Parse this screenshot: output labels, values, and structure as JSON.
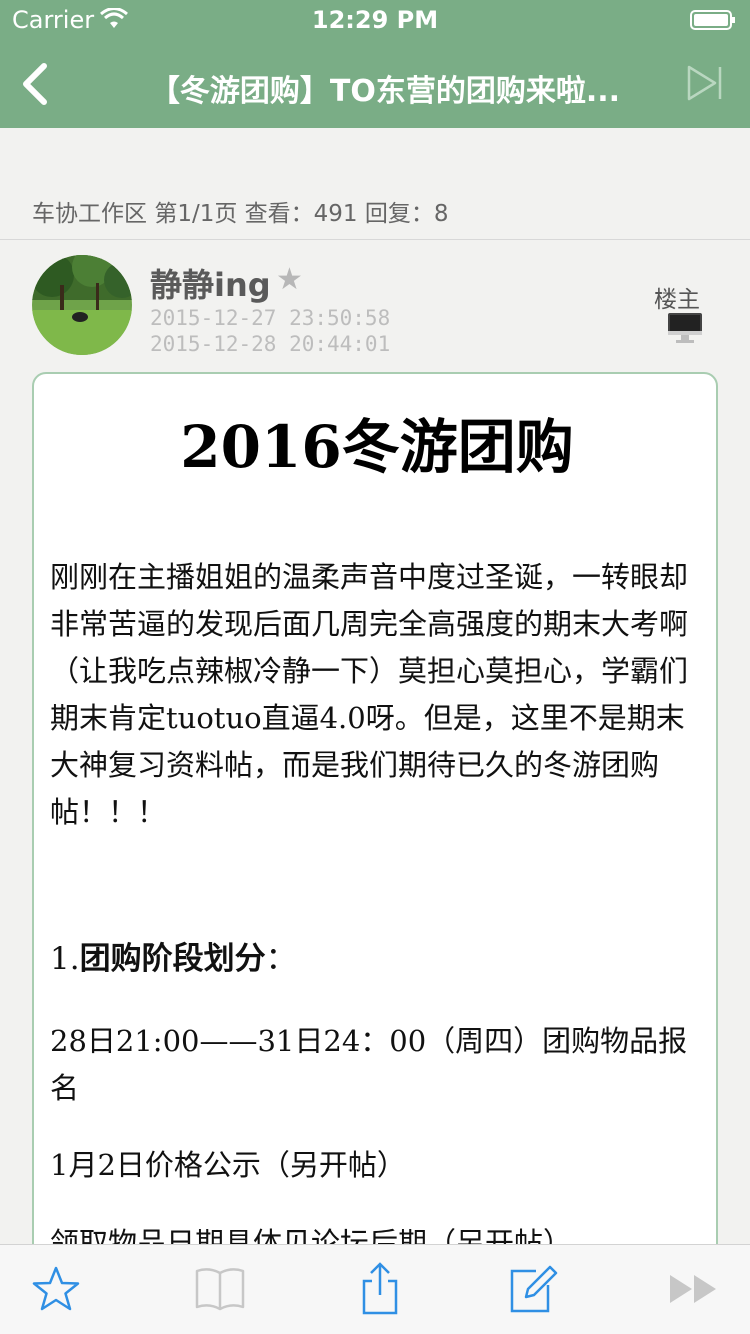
{
  "status_bar": {
    "carrier": "Carrier",
    "time": "12:29 PM"
  },
  "nav": {
    "title": "【冬游团购】TO东营的团购来啦...",
    "back_icon": "chevron-left-icon",
    "skip_icon": "skip-to-end-icon"
  },
  "info": {
    "forum": "车协工作区",
    "page": "第1/1页",
    "views": "查看：491",
    "replies": "回复：8"
  },
  "post": {
    "author": "静静ing",
    "posted_at": "2015-12-27 23:50:58",
    "edited_at": "2015-12-28 20:44:01",
    "floor_label": "楼主",
    "device_icon": "desktop-computer-icon"
  },
  "content": {
    "title": "2016冬游团购",
    "intro": "刚刚在主播姐姐的温柔声音中度过圣诞，一转眼却非常苦逼的发现后面几周完全高强度的期末大考啊（让我吃点辣椒冷静一下）莫担心莫担心，学霸们期末肯定tuotuo直逼4.0呀。但是，这里不是期末大神复习资料帖，而是我们期待已久的冬游团购帖！！！",
    "section_number": "1.",
    "section_title": "团购阶段划分",
    "section_colon": "：",
    "line1": "28日21:00——31日24：00（周四）团购物品报名",
    "line2": "1月2日价格公示（另开帖）",
    "line3": "领取物品日期具体见论坛后期（另开帖）"
  },
  "toolbar": {
    "items": [
      "star-icon",
      "book-icon",
      "share-icon",
      "compose-icon",
      "fast-forward-icon"
    ]
  },
  "colors": {
    "nav_bg": "#7aad86",
    "accent_blue": "#2f8fe4",
    "card_border": "#a9cdb1"
  }
}
